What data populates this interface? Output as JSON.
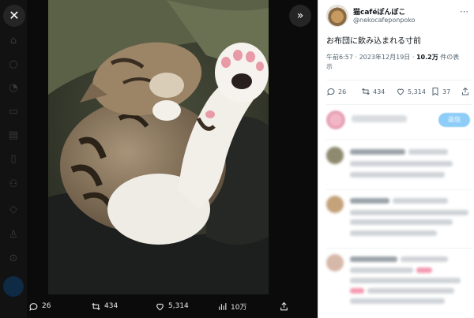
{
  "viewer": {
    "close_icon": "close-icon",
    "expand_icon": "chevron-double-right-icon",
    "actions": {
      "reply_count": "26",
      "retweet_count": "434",
      "like_count": "5,314",
      "views_count": "10万"
    }
  },
  "tweet": {
    "author_name": "猫caféぽんぽこ",
    "author_handle": "@nekocafeponpoko",
    "text": "お布団に飲み込まれる寸前",
    "time": "午前6:57 · 2023年12月19日 · ",
    "views_count": "10.2万",
    "views_suffix": " 件の表",
    "views_suffix2": "示",
    "stats": {
      "replies": "26",
      "retweets": "434",
      "likes": "5,314",
      "bookmarks": "37"
    }
  },
  "reply_button_label": "返信",
  "colors": {
    "accent": "#1d9bf0",
    "text_primary": "#0f1419",
    "text_secondary": "#536471"
  }
}
